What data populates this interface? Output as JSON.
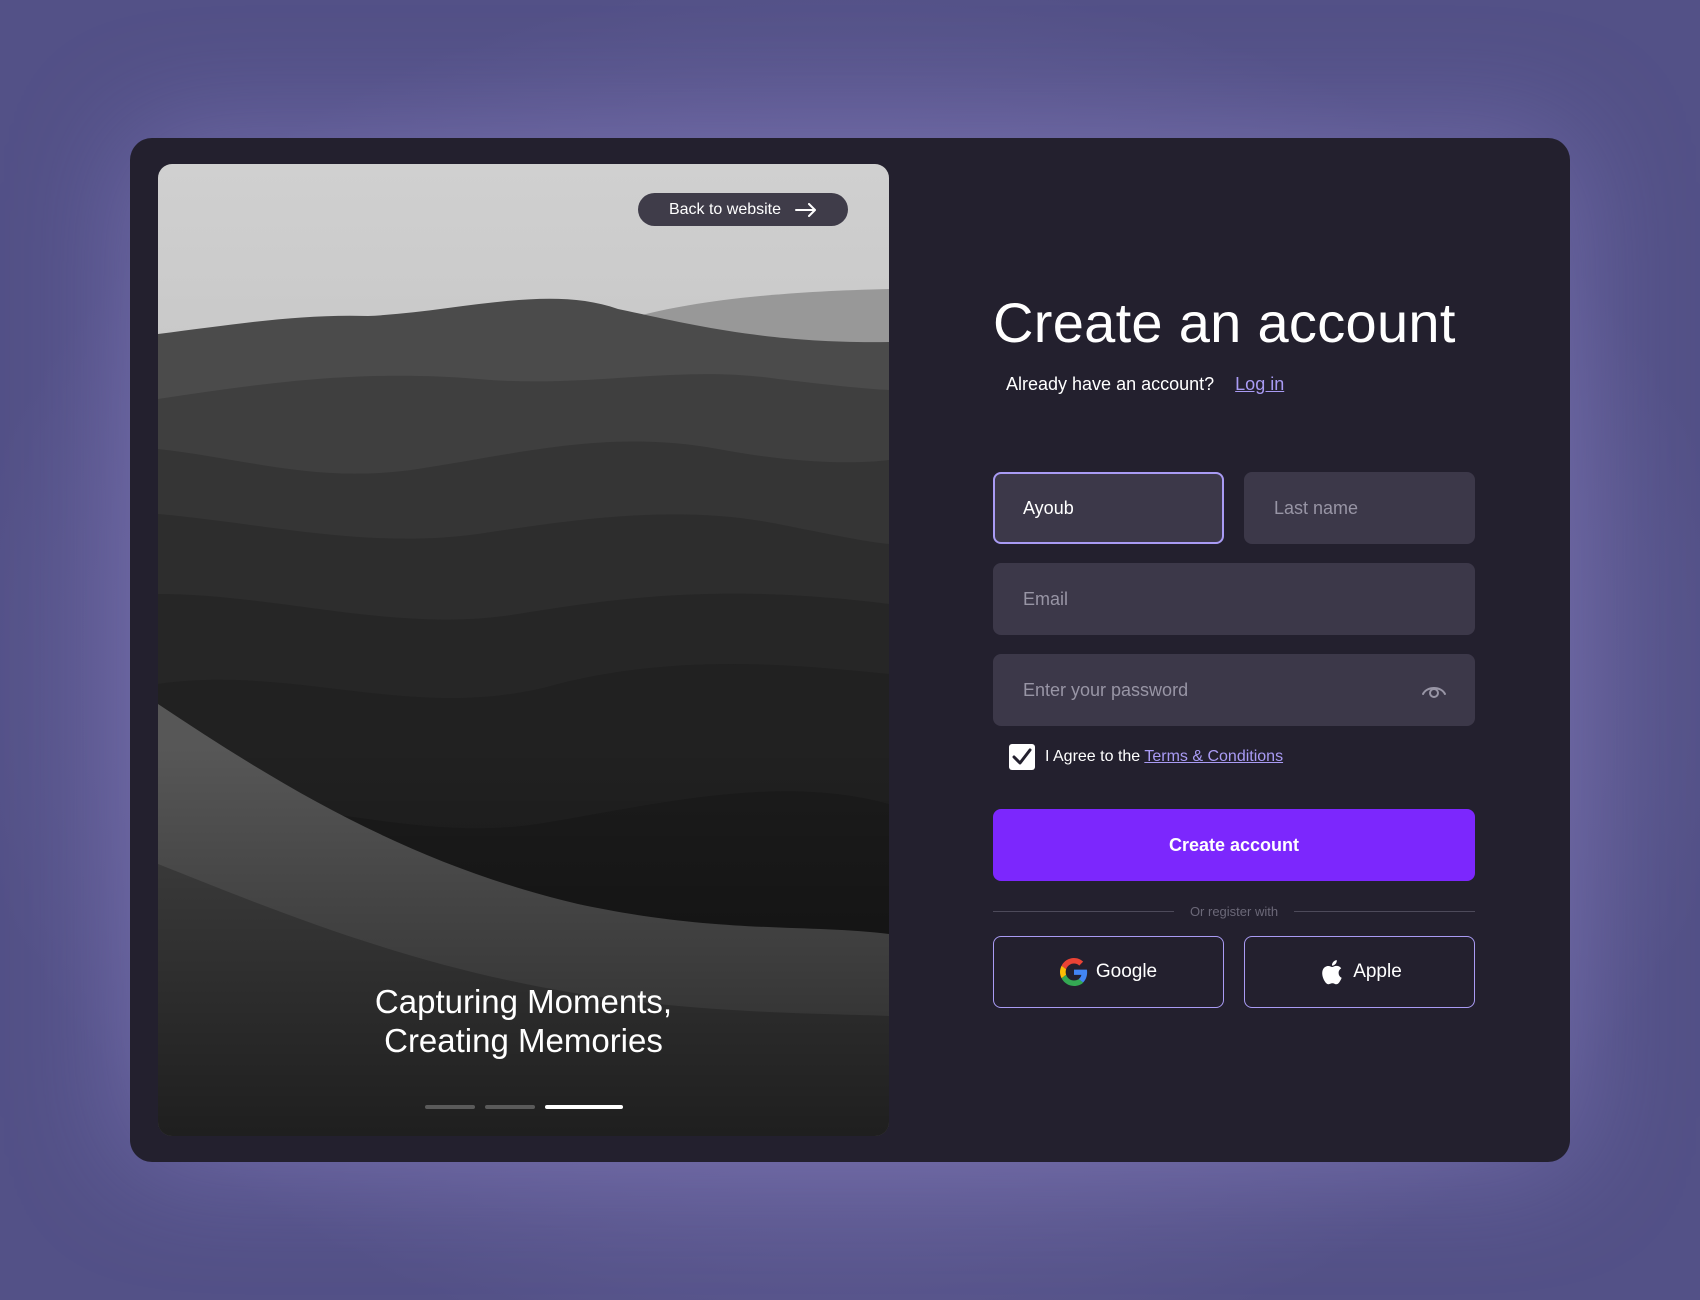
{
  "hero": {
    "back_label": "Back to website",
    "tagline_line1": "Capturing Moments,",
    "tagline_line2": "Creating Memories",
    "carousel": {
      "total": 3,
      "active_index": 3
    }
  },
  "form": {
    "title": "Create an account",
    "login_prompt": "Already have an account?",
    "login_link": "Log in",
    "first_name_value": "Ayoub",
    "last_name_placeholder": "Last name",
    "email_placeholder": "Email",
    "password_placeholder": "Enter your password",
    "agree_text": "I Agree to the",
    "terms_link": "Terms & Conditions",
    "agree_checked": true,
    "submit_label": "Create account",
    "divider_label": "Or register with",
    "google_label": "Google",
    "apple_label": "Apple"
  },
  "colors": {
    "accent": "#7c27fd",
    "link": "#a99bf4",
    "card_background": "#23202e",
    "field_background": "#3c3849"
  },
  "icons": [
    "arrow-right-icon",
    "eye-icon",
    "checkmark-icon",
    "google-icon",
    "apple-icon"
  ]
}
